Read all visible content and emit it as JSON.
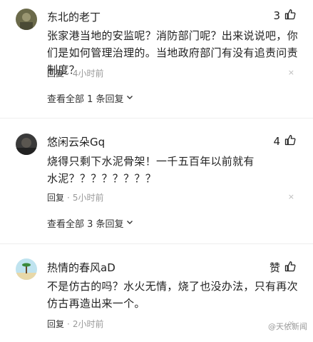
{
  "comments": [
    {
      "username": "东北的老丁",
      "likes": "3",
      "text": "张家港当地的安监呢？消防部门呢？出来说说吧，你们是如何管理治理的。当地政府部门有没有追责问责制度？",
      "reply_label": "回复",
      "dot": "·",
      "time": "4小时前",
      "close": "×",
      "view_all": "查看全部 1 条回复"
    },
    {
      "username": "悠闲云朵Gq",
      "likes": "4",
      "text": "烧得只剩下水泥骨架！一千五百年以前就有水泥？？？？？？？？",
      "reply_label": "回复",
      "dot": "·",
      "time": "5小时前",
      "close": "×",
      "view_all": "查看全部 3 条回复"
    },
    {
      "username": "热情的春风aD",
      "likes": "赞",
      "text": "不是仿古的吗？水火无情，烧了也没办法，只有再次仿古再造出来一个。",
      "reply_label": "回复",
      "dot": "·",
      "time": "2小时前",
      "close": "×"
    }
  ],
  "watermark": "@天依新闻",
  "icons": {
    "like": "thumbs-up-icon",
    "chevron": "chevron-down-icon",
    "close": "close-icon"
  }
}
